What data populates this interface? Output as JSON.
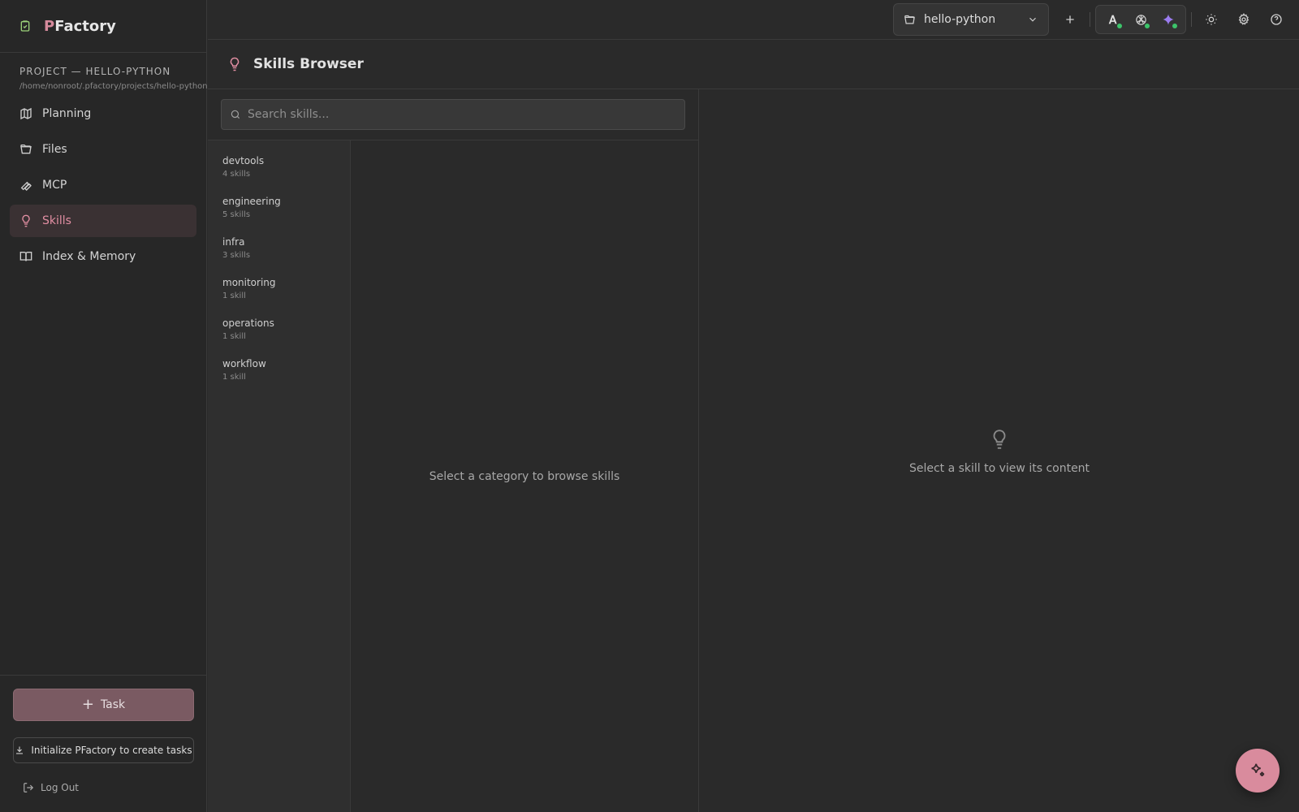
{
  "brand": {
    "prefix": "P",
    "rest": "Factory"
  },
  "project": {
    "title": "PROJECT — HELLO-PYTHON",
    "path": "/home/nonroot/.pfactory/projects/hello-python"
  },
  "nav": [
    {
      "label": "Planning",
      "icon": "map-icon"
    },
    {
      "label": "Files",
      "icon": "folder-icon"
    },
    {
      "label": "MCP",
      "icon": "wrench-icon"
    },
    {
      "label": "Skills",
      "icon": "lightbulb-icon",
      "active": true
    },
    {
      "label": "Index & Memory",
      "icon": "book-icon"
    }
  ],
  "sidebar_bottom": {
    "task_label": "Task",
    "init_label": "Initialize PFactory to create tasks",
    "logout_label": "Log Out"
  },
  "topbar": {
    "project_select": "hello-python"
  },
  "page": {
    "title": "Skills Browser",
    "search_placeholder": "Search skills..."
  },
  "categories": [
    {
      "name": "devtools",
      "count": "4 skills"
    },
    {
      "name": "engineering",
      "count": "5 skills"
    },
    {
      "name": "infra",
      "count": "3 skills"
    },
    {
      "name": "monitoring",
      "count": "1 skill"
    },
    {
      "name": "operations",
      "count": "1 skill"
    },
    {
      "name": "workflow",
      "count": "1 skill"
    }
  ],
  "empty": {
    "skills": "Select a category to browse skills",
    "content": "Select a skill to view its content"
  },
  "colors": {
    "accent": "#d98b9d",
    "background": "#2a2a2a",
    "status_online": "#3cc46a"
  }
}
